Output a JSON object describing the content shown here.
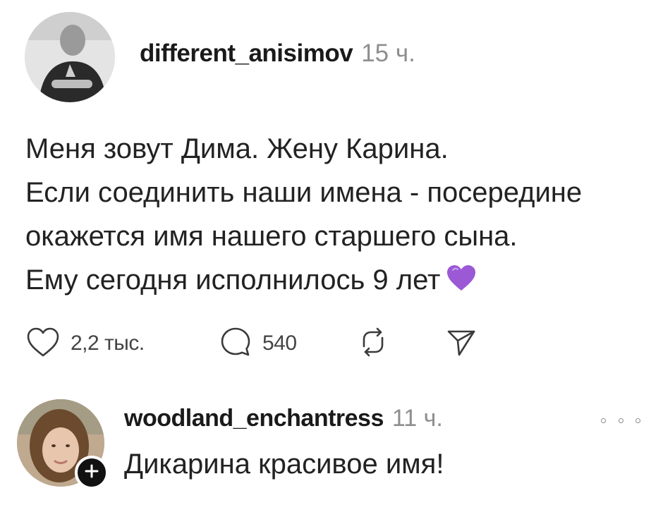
{
  "post": {
    "username": "different_anisimov",
    "time": "15 ч.",
    "text_lines": [
      "Меня зовут Дима. Жену Карина.",
      "Если соединить наши имена - посередине",
      "окажется имя нашего старшего сына.",
      "Ему сегодня исполнилось 9 лет"
    ],
    "emoji": "purple-heart-icon",
    "actions": {
      "likes": "2,2 тыс.",
      "comments": "540"
    }
  },
  "reply": {
    "username": "woodland_enchantress",
    "time": "11 ч.",
    "text": "Дикарина красивое имя!"
  },
  "colors": {
    "accent_purple": "#9b59d6",
    "badge_black": "#111111",
    "muted_gray": "#8e8e8e"
  }
}
